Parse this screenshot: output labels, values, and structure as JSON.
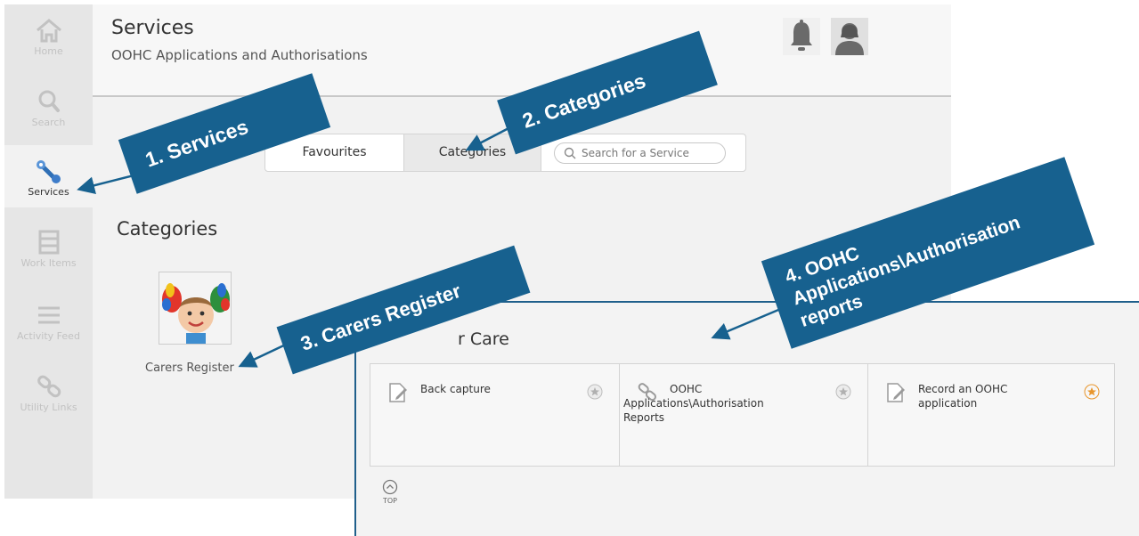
{
  "sidebar": {
    "items": [
      {
        "label": "Home",
        "icon": "home-icon"
      },
      {
        "label": "Search",
        "icon": "search-icon"
      },
      {
        "label": "Services",
        "icon": "wrench-icon",
        "active": true
      },
      {
        "label": "Work Items",
        "icon": "work-items-icon"
      },
      {
        "label": "Activity Feed",
        "icon": "activity-feed-icon"
      },
      {
        "label": "Utility Links",
        "icon": "link-icon"
      }
    ]
  },
  "header": {
    "title": "Services",
    "subtitle": "OOHC Applications and Authorisations",
    "icons": [
      "bell-icon",
      "user-avatar-icon"
    ]
  },
  "tabs": {
    "favourites": "Favourites",
    "categories": "Categories",
    "search_placeholder": "Search for a Service"
  },
  "main": {
    "section_title": "Categories",
    "category": {
      "label": "Carers Register"
    }
  },
  "inset": {
    "heading": "r Care",
    "cards": [
      {
        "name": "Back capture",
        "icon": "edit-document-icon",
        "favourite": false
      },
      {
        "name_line1": "OOHC",
        "name_line2": "Applications\\Authorisation",
        "name_line3": "Reports",
        "icon": "link-icon",
        "favourite": false
      },
      {
        "name_line1": "Record an OOHC",
        "name_line2": "application",
        "icon": "edit-document-icon",
        "favourite": true
      }
    ],
    "top_label": "TOP"
  },
  "callouts": {
    "c1": "1. Services",
    "c2": "2. Categories",
    "c3": "3. Carers Register",
    "c4_line1": "4. OOHC",
    "c4_line2": "Applications\\Authorisation",
    "c4_line3": "reports"
  },
  "colors": {
    "callout": "#17618f",
    "star_active": "#e8952b",
    "sidebar_bg": "#e6e6e6"
  }
}
